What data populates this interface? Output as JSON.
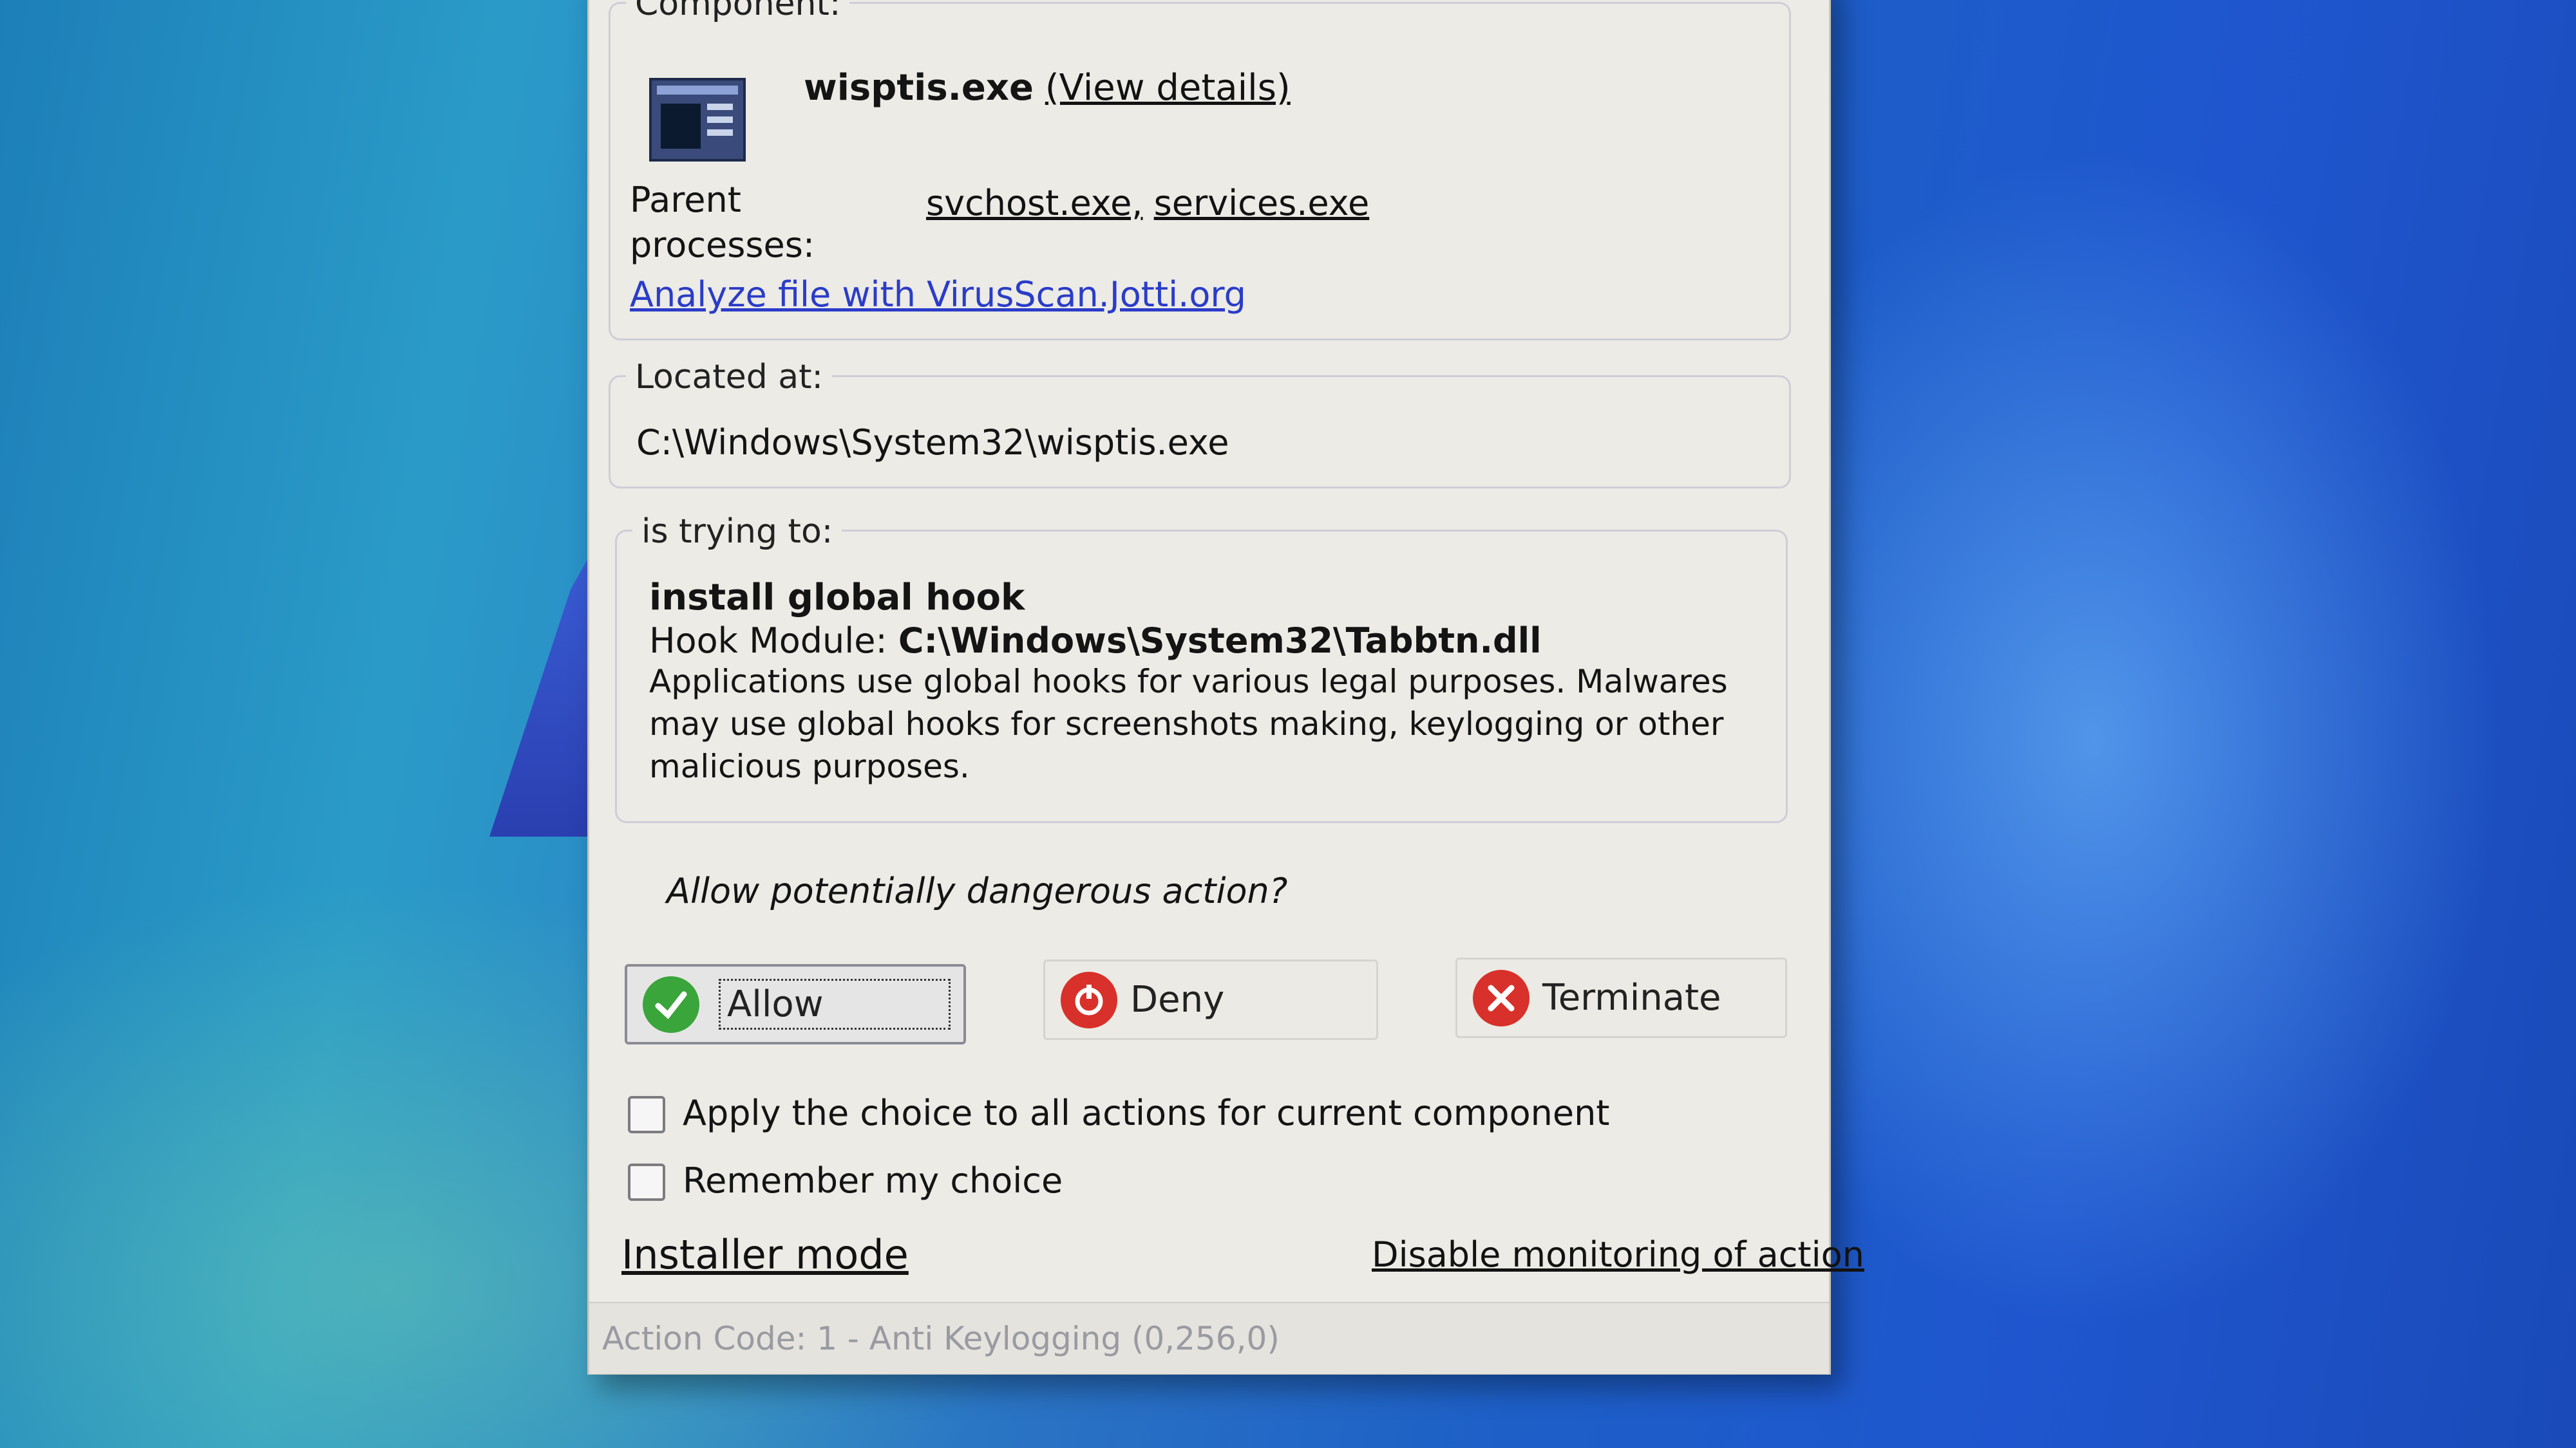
{
  "component": {
    "legend": "Component:",
    "filename": "wisptis.exe",
    "view_details": "(View details)",
    "parent_label_line1": "Parent",
    "parent_label_line2": "processes:",
    "parent_1": "svchost.exe,",
    "parent_2": "services.exe",
    "analyze_link": "Analyze file with VirusScan.Jotti.org",
    "icon": "application-window-icon"
  },
  "location": {
    "legend": "Located at:",
    "path": "C:\\Windows\\System32\\wisptis.exe"
  },
  "action": {
    "legend": "is trying to:",
    "title": "install global hook",
    "module_label": "Hook Module:",
    "module_path": "C:\\Windows\\System32\\Tabbtn.dll",
    "desc_1": "Applications use global hooks for various legal purposes. Malwares",
    "desc_2": "may use global hooks for screenshots making, keylogging or other",
    "desc_3": "malicious purposes."
  },
  "question": "Allow potentially dangerous action?",
  "buttons": {
    "allow": "Allow",
    "deny": "Deny",
    "terminate": "Terminate"
  },
  "options": {
    "apply_all": "Apply the choice to all actions for current component",
    "remember": "Remember my choice"
  },
  "links": {
    "installer_mode": "Installer mode",
    "disable_monitoring": "Disable monitoring of action"
  },
  "status": "Action Code: 1 - Anti Keylogging (0,256,0)",
  "colors": {
    "allow_icon": "#3aa53a",
    "deny_icon": "#d8302a",
    "terminate_icon": "#d8302a",
    "link_blue": "#2a3cc8"
  }
}
